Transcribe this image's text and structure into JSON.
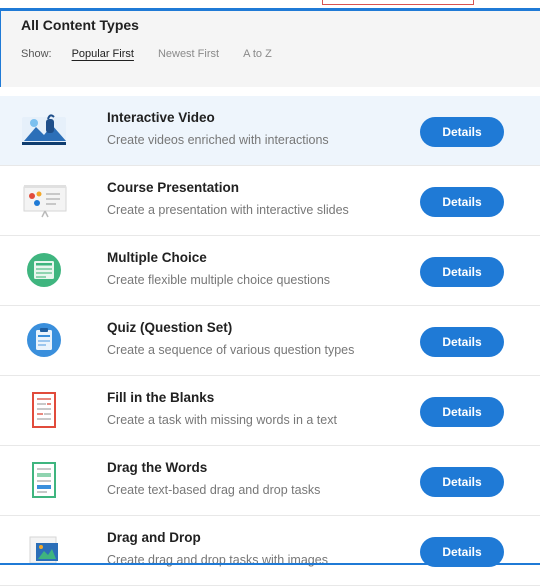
{
  "header": {
    "title": "All Content Types",
    "show_label": "Show:",
    "sort_options": [
      "Popular First",
      "Newest First",
      "A to Z"
    ],
    "active_sort": "Popular First"
  },
  "content_types": [
    {
      "name": "Interactive Video",
      "description": "Create videos enriched with interactions",
      "icon": "interactive-video-icon",
      "button": "Details"
    },
    {
      "name": "Course Presentation",
      "description": "Create a presentation with interactive slides",
      "icon": "course-presentation-icon",
      "button": "Details"
    },
    {
      "name": "Multiple Choice",
      "description": "Create flexible multiple choice questions",
      "icon": "multiple-choice-icon",
      "button": "Details"
    },
    {
      "name": "Quiz (Question Set)",
      "description": "Create a sequence of various question types",
      "icon": "quiz-icon",
      "button": "Details"
    },
    {
      "name": "Fill in the Blanks",
      "description": "Create a task with missing words in a text",
      "icon": "fill-in-the-blanks-icon",
      "button": "Details"
    },
    {
      "name": "Drag the Words",
      "description": "Create text-based drag and drop tasks",
      "icon": "drag-the-words-icon",
      "button": "Details"
    },
    {
      "name": "Drag and Drop",
      "description": "Create drag and drop tasks with images",
      "icon": "drag-and-drop-icon",
      "button": "Details"
    }
  ],
  "colors": {
    "accent": "#1f7ad6",
    "highlight_row": "#eef5fc",
    "header_bg": "#f5f5f5"
  }
}
